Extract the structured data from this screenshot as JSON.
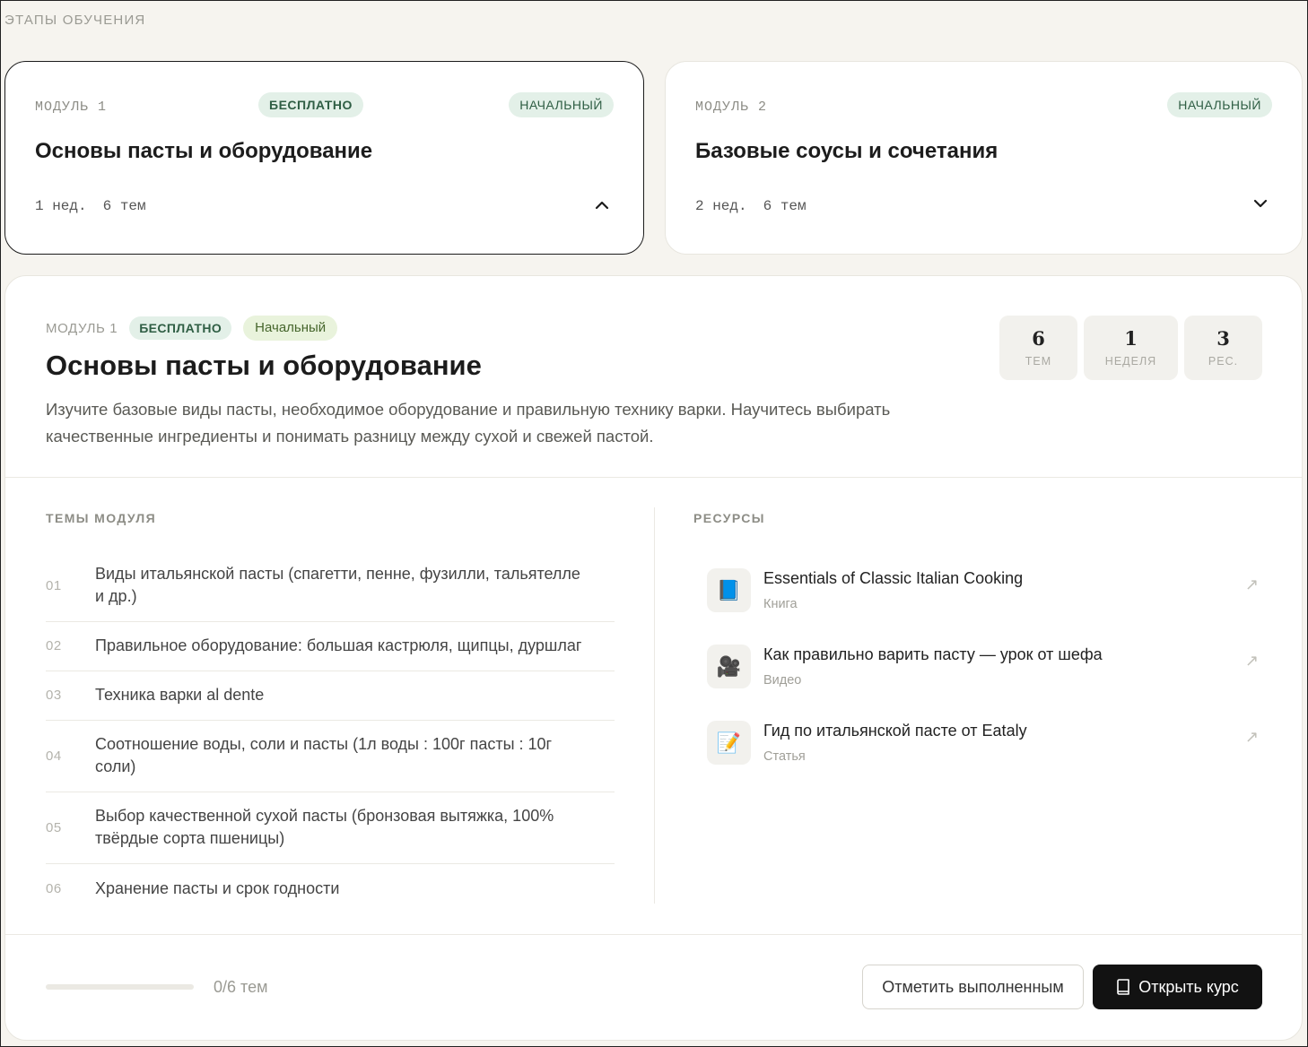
{
  "section_title": "ЭТАПЫ ОБУЧЕНИЯ",
  "modules": [
    {
      "label": "МОДУЛЬ 1",
      "free_badge": "БЕСПЛАТНО",
      "level": "НАЧАЛЬНЫЙ",
      "title": "Основы пасты и оборудование",
      "weeks": "1 нед.",
      "topics": "6 тем",
      "chevron": "chevron-up-icon"
    },
    {
      "label": "МОДУЛЬ 2",
      "level": "НАЧАЛЬНЫЙ",
      "title": "Базовые соусы и сочетания",
      "weeks": "2 нед.",
      "topics": "6 тем",
      "chevron": "chevron-down-icon"
    }
  ],
  "detail": {
    "module_label": "МОДУЛЬ 1",
    "free_badge": "БЕСПЛАТНО",
    "level": "Начальный",
    "title": "Основы пасты и оборудование",
    "description": "Изучите базовые виды пасты, необходимое оборудование и правильную технику варки. Научитесь выбирать качественные ингредиенты и понимать разницу между сухой и свежей пастой.",
    "stats": [
      {
        "value": "6",
        "label": "ТЕМ"
      },
      {
        "value": "1",
        "label": "НЕДЕЛЯ"
      },
      {
        "value": "3",
        "label": "РЕС."
      }
    ],
    "topics_title": "ТЕМЫ МОДУЛЯ",
    "topics": [
      {
        "num": "01",
        "text": "Виды итальянской пасты (спагетти, пенне, фузилли, тальятелле и др.)"
      },
      {
        "num": "02",
        "text": "Правильное оборудование: большая кастрюля, щипцы, дуршлаг"
      },
      {
        "num": "03",
        "text": "Техника варки al dente"
      },
      {
        "num": "04",
        "text": "Соотношение воды, соли и пасты (1л воды : 100г пасты : 10г соли)"
      },
      {
        "num": "05",
        "text": "Выбор качественной сухой пасты (бронзовая вытяжка, 100% твёрдые сорта пшеницы)"
      },
      {
        "num": "06",
        "text": "Хранение пасты и срок годности"
      }
    ],
    "resources_title": "РЕСУРСЫ",
    "resources": [
      {
        "icon": "📘",
        "icon_name": "book-icon",
        "title": "Essentials of Classic Italian Cooking",
        "type": "Книга",
        "arrow": "↗"
      },
      {
        "icon": "🎥",
        "icon_name": "video-camera-icon",
        "title": "Как правильно варить пасту — урок от шефа",
        "type": "Видео",
        "arrow": "↗"
      },
      {
        "icon": "📝",
        "icon_name": "memo-icon",
        "title": "Гид по итальянской пасте от Eataly",
        "type": "Статья",
        "arrow": "↗"
      }
    ],
    "progress_fraction": 0,
    "progress_text": "0/6 тем",
    "mark_done_label": "Отметить выполненным",
    "open_course_label": "Открыть курс"
  }
}
